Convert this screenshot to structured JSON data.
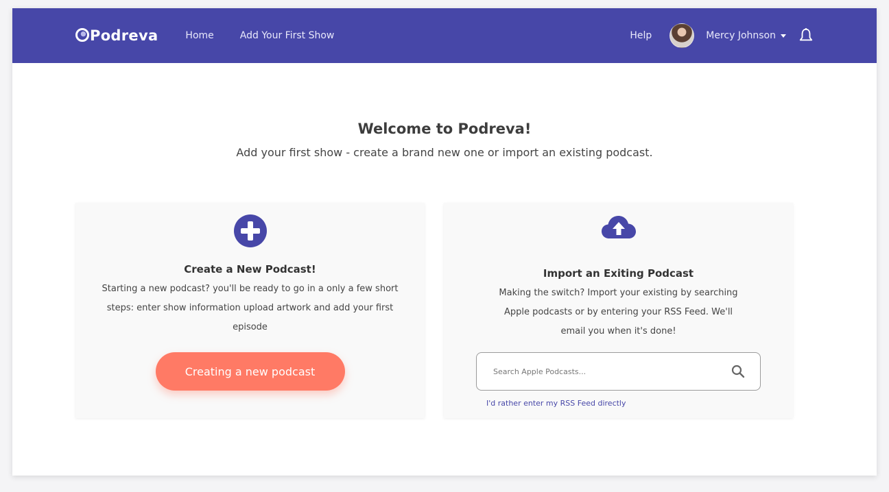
{
  "navbar": {
    "brand": "Podreva",
    "links": [
      "Home",
      "Add Your First Show"
    ],
    "help": "Help",
    "user_name": "Mercy Johnson",
    "bg_color": "#4747a8"
  },
  "hero": {
    "title": "Welcome to Podreva!",
    "subtitle": "Add your first show - create a brand new one or import an existing podcast."
  },
  "create_card": {
    "icon": "plus-circle-icon",
    "title": "Create a New Podcast!",
    "description": "Starting a new podcast?  you'll be ready to go in a only a few short  steps: enter show information upload artwork and add your first episode",
    "button_label": "Creating a new podcast",
    "button_color": "#ff7a65"
  },
  "import_card": {
    "icon": "cloud-upload-icon",
    "title": "Import an Exiting Podcast",
    "description": "Making the switch? Import your existing by searching Apple podcasts or by entering your RSS Feed. We'll email you when it's done!",
    "search_placeholder": "Search Apple Podcasts...",
    "search_value": "",
    "rss_link": "I'd rather enter my RSS Feed directly"
  }
}
